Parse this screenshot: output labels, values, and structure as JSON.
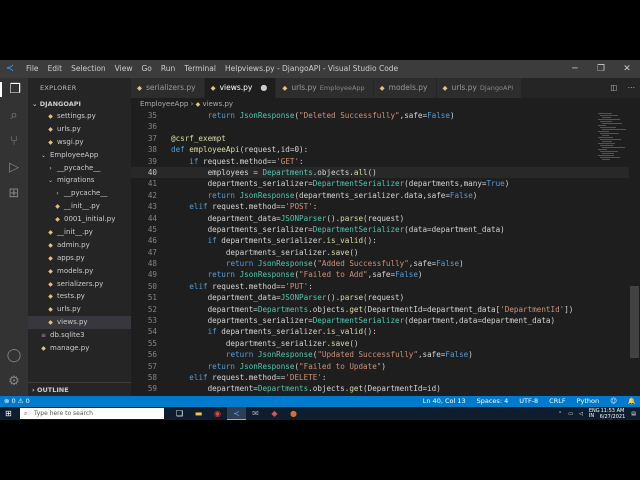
{
  "window": {
    "title": "views.py - DjangoAPI - Visual Studio Code"
  },
  "menu": [
    "File",
    "Edit",
    "Selection",
    "View",
    "Go",
    "Run",
    "Terminal",
    "Help"
  ],
  "window_controls": [
    "─",
    "❐",
    "✕"
  ],
  "activity_icons": [
    "explorer-icon",
    "search-icon",
    "source-control-icon",
    "run-icon",
    "extensions-icon",
    "accounts-icon",
    "settings-icon"
  ],
  "sidebar": {
    "title": "EXPLORER",
    "project": "DJANGOAPI",
    "items": [
      {
        "label": "settings.py",
        "indent": 2,
        "icon": "py"
      },
      {
        "label": "urls.py",
        "indent": 2,
        "icon": "py"
      },
      {
        "label": "wsgi.py",
        "indent": 2,
        "icon": "py"
      },
      {
        "label": "EmployeeApp",
        "indent": 1,
        "icon": "folder-open"
      },
      {
        "label": "__pycache__",
        "indent": 2,
        "icon": "folder"
      },
      {
        "label": "migrations",
        "indent": 2,
        "icon": "folder-open"
      },
      {
        "label": "__pycache__",
        "indent": 3,
        "icon": "folder"
      },
      {
        "label": "__init__.py",
        "indent": 3,
        "icon": "py"
      },
      {
        "label": "0001_initial.py",
        "indent": 3,
        "icon": "py"
      },
      {
        "label": "__init__.py",
        "indent": 2,
        "icon": "py"
      },
      {
        "label": "admin.py",
        "indent": 2,
        "icon": "py"
      },
      {
        "label": "apps.py",
        "indent": 2,
        "icon": "py"
      },
      {
        "label": "models.py",
        "indent": 2,
        "icon": "py"
      },
      {
        "label": "serializers.py",
        "indent": 2,
        "icon": "py"
      },
      {
        "label": "tests.py",
        "indent": 2,
        "icon": "py"
      },
      {
        "label": "urls.py",
        "indent": 2,
        "icon": "py"
      },
      {
        "label": "views.py",
        "indent": 2,
        "icon": "py",
        "selected": true
      },
      {
        "label": "db.sqlite3",
        "indent": 1,
        "icon": "db"
      },
      {
        "label": "manage.py",
        "indent": 1,
        "icon": "py"
      }
    ],
    "outline": "OUTLINE"
  },
  "tabs": [
    {
      "label": "serializers.py",
      "desc": "",
      "active": false
    },
    {
      "label": "views.py",
      "desc": "",
      "active": true,
      "dirty": true
    },
    {
      "label": "urls.py",
      "desc": "EmployeeApp",
      "active": false
    },
    {
      "label": "models.py",
      "desc": "",
      "active": false
    },
    {
      "label": "urls.py",
      "desc": "DjangoAPI",
      "active": false
    }
  ],
  "breadcrumb": [
    "EmployeeApp",
    "views.py"
  ],
  "code_lines": [
    {
      "n": "35",
      "text": "        return JsonResponse(\"Deleted Successfully\",safe=False)"
    },
    {
      "n": "36",
      "text": ""
    },
    {
      "n": "37",
      "text": "@csrf_exempt"
    },
    {
      "n": "38",
      "text": "def employeeApi(request,id=0):"
    },
    {
      "n": "39",
      "text": "    if request.method=='GET':"
    },
    {
      "n": "40",
      "text": "        employees = Departments.objects.all()",
      "current": true
    },
    {
      "n": "41",
      "text": "        departments_serializer=DepartmentSerializer(departments,many=True)"
    },
    {
      "n": "42",
      "text": "        return JsonResponse(departments_serializer.data,safe=False)"
    },
    {
      "n": "43",
      "text": "    elif request.method=='POST':"
    },
    {
      "n": "44",
      "text": "        department_data=JSONParser().parse(request)"
    },
    {
      "n": "45",
      "text": "        departments_serializer=DepartmentSerializer(data=department_data)"
    },
    {
      "n": "46",
      "text": "        if departments_serializer.is_valid():"
    },
    {
      "n": "47",
      "text": "            departments_serializer.save()"
    },
    {
      "n": "48",
      "text": "            return JsonResponse(\"Added Successfully\",safe=False)"
    },
    {
      "n": "49",
      "text": "        return JsonResponse(\"Failed to Add\",safe=False)"
    },
    {
      "n": "50",
      "text": "    elif request.method=='PUT':"
    },
    {
      "n": "51",
      "text": "        department_data=JSONParser().parse(request)"
    },
    {
      "n": "52",
      "text": "        department=Departments.objects.get(DepartmentId=department_data['DepartmentId'])"
    },
    {
      "n": "53",
      "text": "        departments_serializer=DepartmentSerializer(department,data=department_data)"
    },
    {
      "n": "54",
      "text": "        if departments_serializer.is_valid():"
    },
    {
      "n": "55",
      "text": "            departments_serializer.save()"
    },
    {
      "n": "56",
      "text": "            return JsonResponse(\"Updated Successfully\",safe=False)"
    },
    {
      "n": "57",
      "text": "        return JsonResponse(\"Failed to Update\")"
    },
    {
      "n": "58",
      "text": "    elif request.method=='DELETE':"
    },
    {
      "n": "59",
      "text": "        department=Departments.objects.get(DepartmentId=id)"
    }
  ],
  "status": {
    "left": "⊗ 0 ⚠ 0",
    "right": [
      "Ln 40, Col 13",
      "Spaces: 4",
      "UTF-8",
      "CRLF",
      "Python",
      "☺",
      "🔔"
    ]
  },
  "taskbar": {
    "search_placeholder": "Type here to search",
    "icons": [
      "task-view-icon",
      "file-explorer-icon",
      "chrome-icon",
      "vscode-icon",
      "mail-icon",
      "app-icon",
      "app-icon"
    ],
    "tray_lang": "ENG\nIN",
    "time": "11:53 AM",
    "date": "6/27/2021"
  }
}
